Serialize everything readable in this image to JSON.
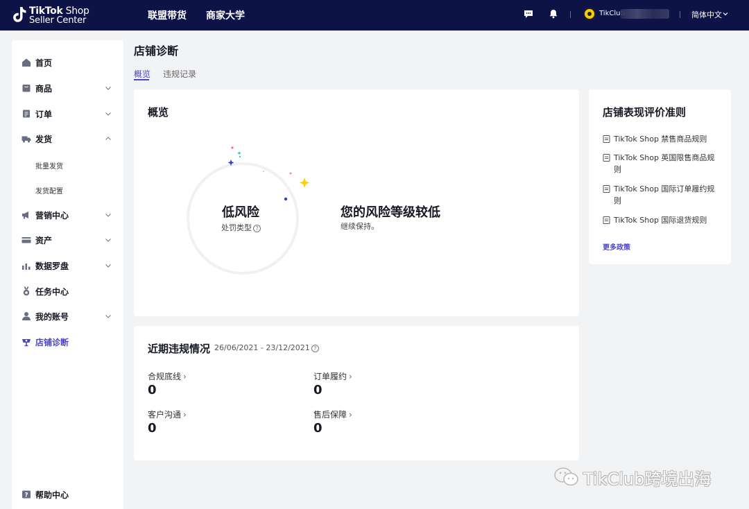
{
  "topbar": {
    "logo_line1_bold": "TikTok",
    "logo_line1_thin": " Shop",
    "logo_line2": "Seller Center",
    "nav": [
      "联盟带货",
      "商家大学"
    ],
    "username": "TikClub",
    "language": "简体中文"
  },
  "sidebar": {
    "items": [
      {
        "label": "首页",
        "icon": "home-icon"
      },
      {
        "label": "商品",
        "icon": "product-icon"
      },
      {
        "label": "订单",
        "icon": "order-icon"
      },
      {
        "label": "发货",
        "icon": "truck-icon"
      },
      {
        "label": "营销中心",
        "icon": "megaphone-icon"
      },
      {
        "label": "资产",
        "icon": "card-icon"
      },
      {
        "label": "数据罗盘",
        "icon": "chart-icon"
      },
      {
        "label": "任务中心",
        "icon": "medal-icon"
      },
      {
        "label": "我的账号",
        "icon": "user-icon"
      },
      {
        "label": "店铺诊断",
        "icon": "diagnosis-icon"
      }
    ],
    "sub_items": [
      "批量发货",
      "发货配置"
    ],
    "help": "帮助中心"
  },
  "page": {
    "title": "店铺诊断",
    "tabs": [
      "概览",
      "违规记录"
    ]
  },
  "overview": {
    "title": "概览",
    "risk_level": "低风险",
    "risk_type": "处罚类型",
    "headline": "您的风险等级较低",
    "subtext": "继续保持。"
  },
  "recent": {
    "title": "近期违规情况",
    "date_range": "26/06/2021 - 23/12/2021",
    "metrics": [
      {
        "label": "合规底线",
        "value": "0"
      },
      {
        "label": "订单履约",
        "value": "0"
      },
      {
        "label": "客户沟通",
        "value": "0"
      },
      {
        "label": "售后保障",
        "value": "0"
      }
    ]
  },
  "rules": {
    "title": "店铺表现评价准则",
    "items": [
      "TikTok Shop 禁售商品规则",
      "TikTok Shop 英国限售商品规则",
      "TikTok Shop 国际订单履约规则",
      "TikTok Shop 国际退货规则"
    ],
    "more": "更多政策"
  },
  "watermark": "TikClub跨境出海",
  "colors": {
    "topbar": "#0e1347",
    "accent": "#4b44c9",
    "background": "#f2f3f5"
  }
}
